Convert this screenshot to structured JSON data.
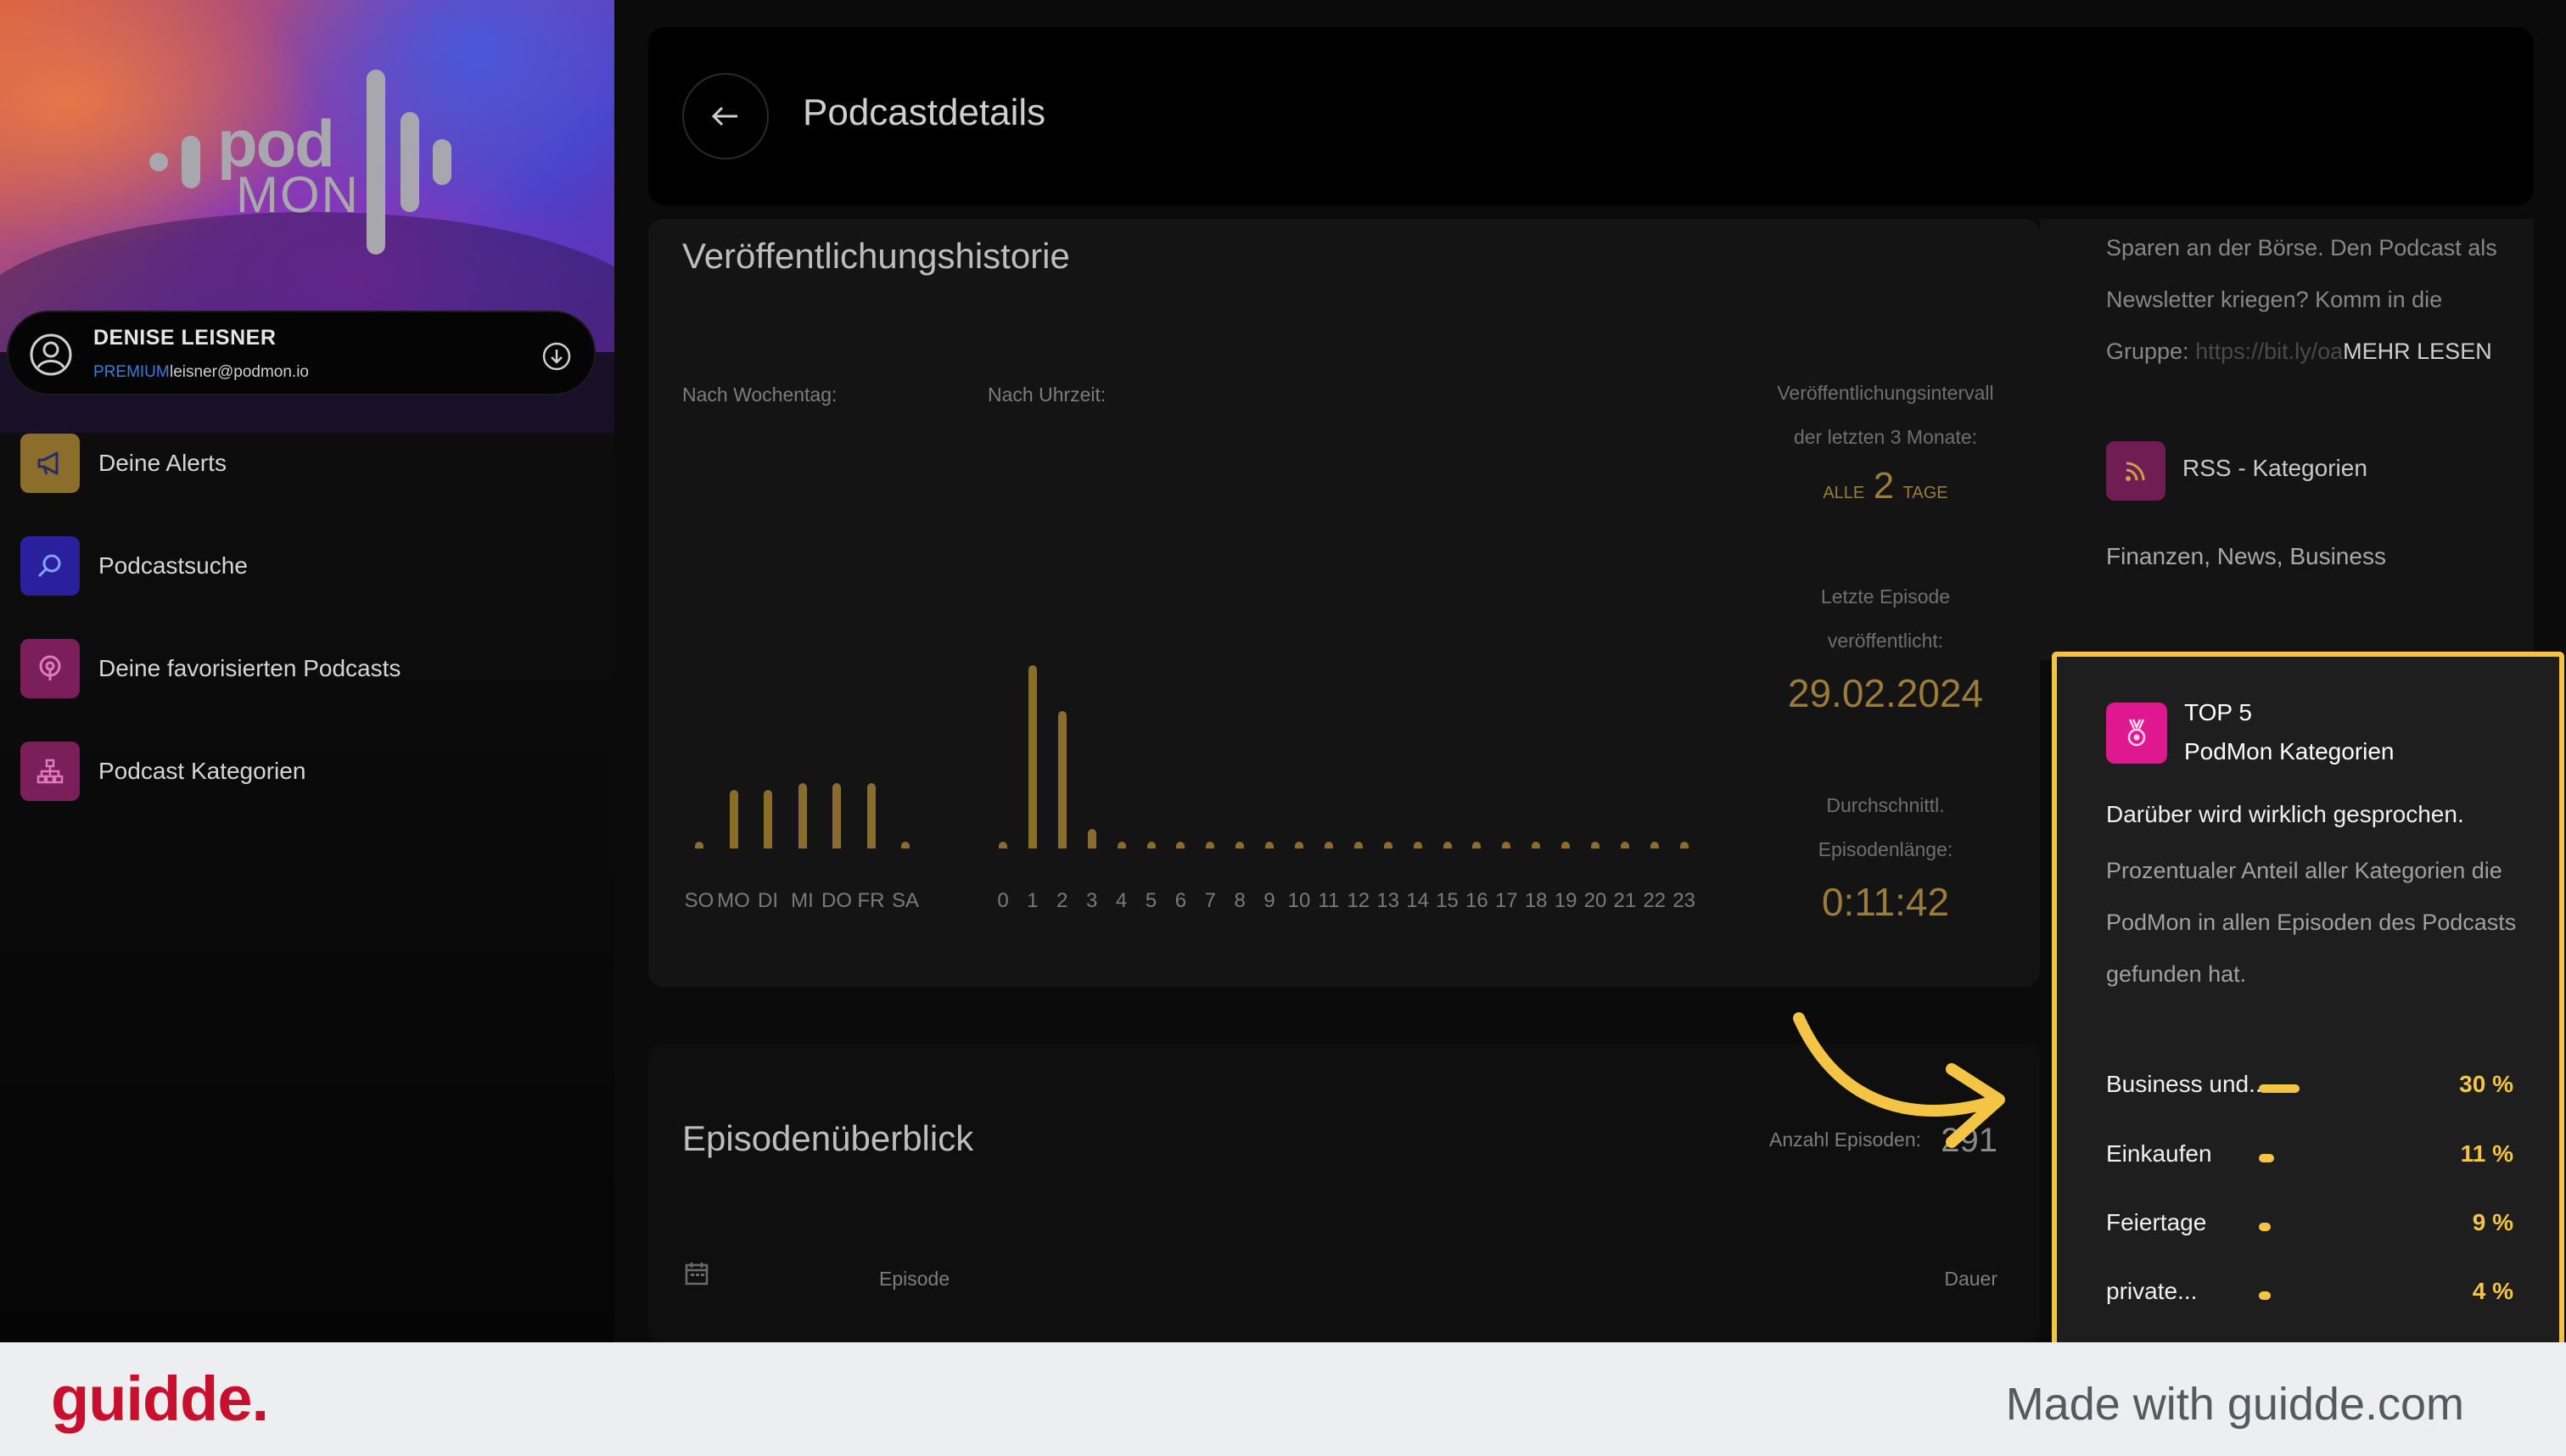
{
  "user": {
    "name": "DENISE LEISNER",
    "plan": "PREMIUM",
    "email": "leisner@podmon.io"
  },
  "nav": [
    {
      "label": "Deine Alerts",
      "color": "#8b6d2c",
      "icon": "megaphone-icon"
    },
    {
      "label": "Podcastsuche",
      "color": "#2a1f9c",
      "icon": "search-icon"
    },
    {
      "label": "Deine favorisierten Podcasts",
      "color": "#7a1f5a",
      "icon": "podcast-icon"
    },
    {
      "label": "Podcast Kategorien",
      "color": "#7a1f5a",
      "icon": "hierarchy-icon"
    }
  ],
  "logo": {
    "line1": "pod",
    "line2": "MON"
  },
  "header": {
    "title": "Podcastdetails"
  },
  "history": {
    "title": "Veröffentlichungshistorie",
    "by_weekday_label": "Nach Wochentag:",
    "by_hour_label": "Nach Uhrzeit:",
    "interval_label_1": "Veröffentlichungsintervall",
    "interval_label_2": "der letzten 3 Monate:",
    "interval_prefix": "ALLE",
    "interval_value": "2",
    "interval_suffix": "TAGE",
    "last_episode_label_1": "Letzte Episode",
    "last_episode_label_2": "veröffentlicht:",
    "last_episode_value": "29.02.2024",
    "avg_length_label_1": "Durchschnittl.",
    "avg_length_label_2": "Episodenlänge:",
    "avg_length_value": "0:11:42"
  },
  "chart_data": [
    {
      "type": "bar",
      "categories": [
        "SO",
        "MO",
        "DI",
        "MI",
        "DO",
        "FR",
        "SA"
      ],
      "values": [
        1,
        9,
        9,
        10,
        10,
        10,
        1
      ],
      "xlabel": "Nach Wochentag:",
      "ylim": [
        0,
        28
      ],
      "grid": false
    },
    {
      "type": "bar",
      "categories": [
        "0",
        "1",
        "2",
        "3",
        "4",
        "5",
        "6",
        "7",
        "8",
        "9",
        "10",
        "11",
        "12",
        "13",
        "14",
        "15",
        "16",
        "17",
        "18",
        "19",
        "20",
        "21",
        "22",
        "23"
      ],
      "values": [
        1,
        28,
        21,
        3,
        1,
        1,
        1,
        1,
        1,
        1,
        1,
        1,
        1,
        1,
        1,
        1,
        1,
        1,
        1,
        1,
        1,
        1,
        1,
        1
      ],
      "xlabel": "Nach Uhrzeit:",
      "ylim": [
        0,
        28
      ],
      "grid": false
    }
  ],
  "episodes": {
    "title": "Episodenüberblick",
    "count_label": "Anzahl Episoden:",
    "count_value": "291",
    "col_episode": "Episode",
    "col_duration": "Dauer"
  },
  "description": {
    "text": "Sparen an der Börse. Den Podcast als Newsletter kriegen? Komm in die Gruppe: ",
    "link": "https://bit.ly/oa",
    "more": "MEHR LESEN"
  },
  "rss": {
    "label": "RSS - Kategorien",
    "cat1": "Finanzen",
    "cat2": "News",
    "cat3": "Business",
    "sep": ","
  },
  "top5": {
    "line1": "TOP 5",
    "line2": "PodMon Kategorien",
    "lead": "Darüber wird wirklich gesprochen.",
    "explanation": "Prozentualer Anteil aller Kategorien die PodMon in allen Episoden des Podcasts gefunden hat.",
    "categories": [
      {
        "name": "Business und...",
        "percent": 30,
        "label": "30 %"
      },
      {
        "name": "Einkaufen",
        "percent": 11,
        "label": "11 %"
      },
      {
        "name": "Feiertage",
        "percent": 9,
        "label": "9 %"
      },
      {
        "name": "private...",
        "percent": 4,
        "label": "4 %"
      }
    ]
  },
  "footer": {
    "brand": "guidde.",
    "made_with": "Made with guidde.com"
  },
  "colors": {
    "accent": "#f4c545",
    "bar": "#8a6d2e",
    "brand": "#c8102e"
  }
}
